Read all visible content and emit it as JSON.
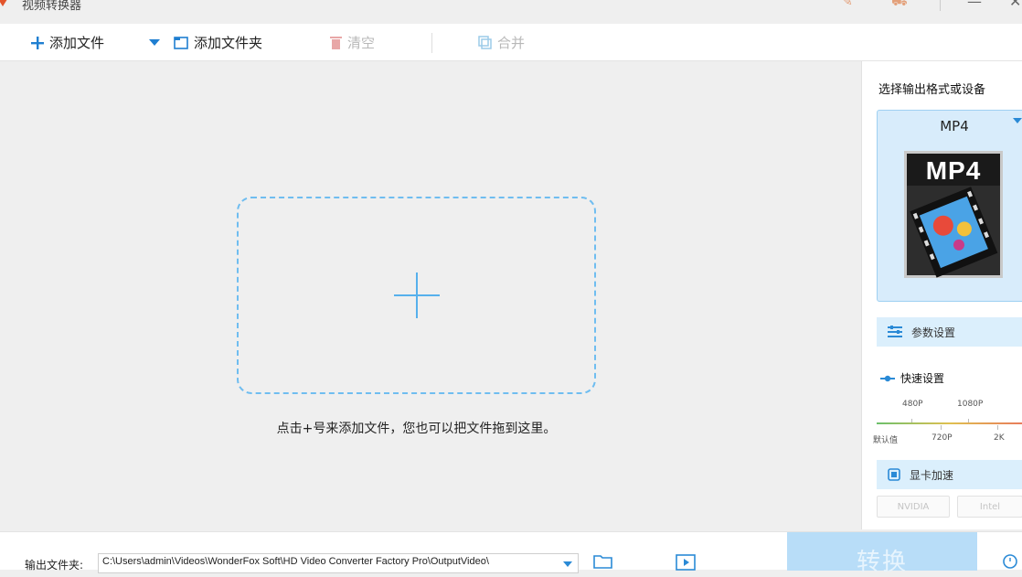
{
  "app": {
    "title": "视频转换器"
  },
  "toolbar": {
    "add_file": "添加文件",
    "add_folder": "添加文件夹",
    "clear": "清空",
    "merge": "合并"
  },
  "dropzone": {
    "hint": "点击+号来添加文件，您也可以把文件拖到这里。"
  },
  "panel": {
    "title": "选择输出格式或设备",
    "format": "MP4",
    "thumbnail_label": "MP4",
    "params_label": "参数设置",
    "quick_label": "快速设置",
    "resolutions_top": [
      "480P",
      "1080P"
    ],
    "resolutions_bottom": [
      "默认值",
      "720P",
      "2K"
    ],
    "gpu_label": "显卡加速",
    "gpu_options": [
      "NVIDIA",
      "Intel"
    ]
  },
  "bottom": {
    "output_label": "输出文件夹:",
    "output_path": "C:\\Users\\admin\\Videos\\WonderFox Soft\\HD Video Converter Factory Pro\\OutputVideo\\",
    "convert_label": "转换"
  },
  "colors": {
    "accent": "#2a8ad6",
    "dashed_border": "#6fbdf0",
    "format_box": "#d8ecfb",
    "convert_button": "#b8ddf8"
  },
  "icons": [
    "app-logo-icon",
    "wrench-icon",
    "cart-icon",
    "minimize-icon",
    "close-icon",
    "plus-icon",
    "folder-add-icon",
    "trash-icon",
    "merge-icon",
    "sliders-icon",
    "speed-icon",
    "chip-icon",
    "folder-open-icon",
    "video-icon",
    "alarm-icon"
  ]
}
